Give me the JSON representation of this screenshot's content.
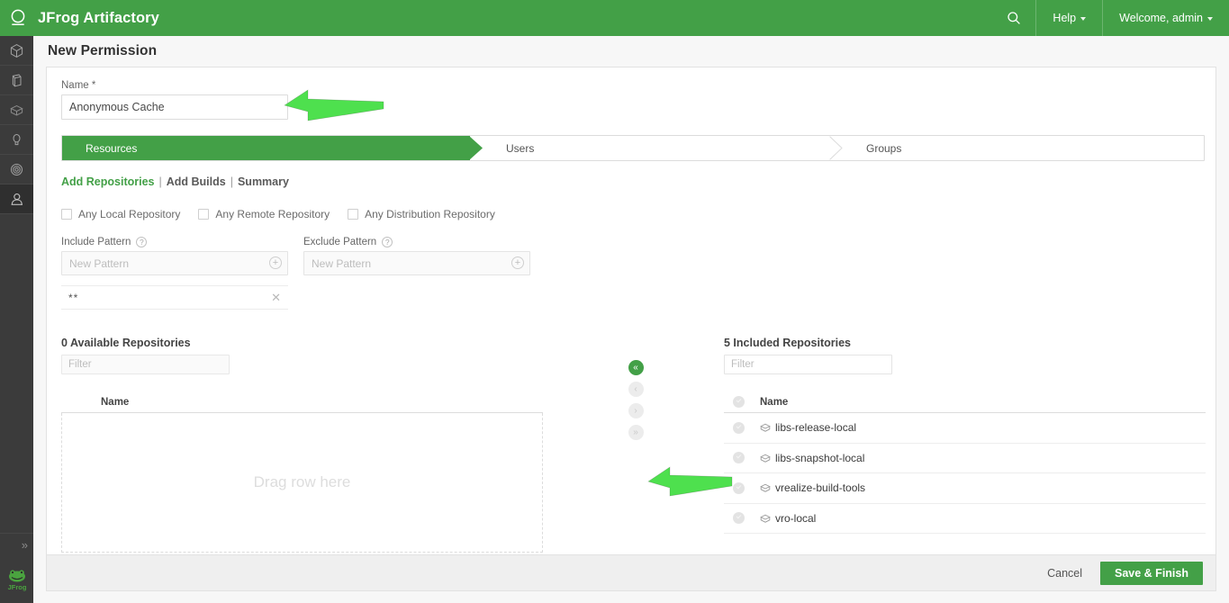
{
  "topbar": {
    "brand": "JFrog Artifactory",
    "logo_icon": "jfrog-circle-logo",
    "search_icon": "search-icon",
    "help_label": "Help",
    "user_label": "Welcome, admin",
    "accent_color": "#43a047"
  },
  "rail": {
    "items": [
      {
        "icon": "artifacts-cube-icon",
        "active": false
      },
      {
        "icon": "package-icon",
        "active": false
      },
      {
        "icon": "builds-box-icon",
        "active": false
      },
      {
        "icon": "search-magnifier-icon",
        "active": false
      },
      {
        "icon": "xray-target-icon",
        "active": false
      },
      {
        "icon": "admin-user-icon",
        "active": true
      }
    ],
    "expand_label": "»",
    "expand_icon": "chevron-double-right-icon",
    "footer_logo_icon": "jfrog-frog-logo"
  },
  "page": {
    "title": "New Permission"
  },
  "form": {
    "name_label": "Name *",
    "name_value": "Anonymous Cache",
    "name_placeholder": ""
  },
  "wizard": {
    "steps": [
      {
        "label": "Resources",
        "active": true
      },
      {
        "label": "Users",
        "active": false
      },
      {
        "label": "Groups",
        "active": false
      }
    ]
  },
  "sublinks": {
    "items": [
      {
        "label": "Add Repositories",
        "active": true
      },
      {
        "label": "Add Builds",
        "active": false
      },
      {
        "label": "Summary",
        "active": false
      }
    ],
    "separator": "|"
  },
  "checkboxes": [
    {
      "label": "Any Local Repository",
      "checked": false
    },
    {
      "label": "Any Remote Repository",
      "checked": false
    },
    {
      "label": "Any Distribution Repository",
      "checked": false
    }
  ],
  "patterns": {
    "include": {
      "label": "Include Pattern",
      "help_icon": "question-mark-icon",
      "placeholder": "New Pattern",
      "value": "",
      "add_icon": "plus-circle-icon"
    },
    "exclude": {
      "label": "Exclude Pattern",
      "help_icon": "question-mark-icon",
      "placeholder": "New Pattern",
      "value": "",
      "add_icon": "plus-circle-icon"
    },
    "chips": [
      {
        "text": "**",
        "remove_icon": "close-x-icon"
      }
    ]
  },
  "available_pane": {
    "title": "0 Available Repositories",
    "filter_placeholder": "Filter",
    "filter_value": "",
    "column_header": "Name",
    "empty_text": "Drag row here",
    "rows": []
  },
  "included_pane": {
    "title": "5 Included Repositories",
    "filter_placeholder": "Filter",
    "filter_value": "",
    "column_header": "Name",
    "rows": [
      {
        "name": "libs-release-local",
        "icon": "repository-cube-icon"
      },
      {
        "name": "libs-snapshot-local",
        "icon": "repository-cube-icon"
      },
      {
        "name": "vrealize-build-tools",
        "icon": "repository-cube-icon"
      },
      {
        "name": "vro-local",
        "icon": "repository-cube-icon"
      }
    ]
  },
  "transfer_buttons": [
    {
      "label": "«",
      "icon": "move-all-left-icon",
      "enabled": true
    },
    {
      "label": "‹",
      "icon": "move-left-icon",
      "enabled": false
    },
    {
      "label": "›",
      "icon": "move-right-icon",
      "enabled": false
    },
    {
      "label": "»",
      "icon": "move-all-right-icon",
      "enabled": false
    }
  ],
  "footer": {
    "cancel_label": "Cancel",
    "save_label": "Save & Finish"
  },
  "annotations": {
    "color": "#4ee04e",
    "arrows": [
      {
        "name": "arrow-pointing-to-name-field",
        "direction": "left"
      },
      {
        "name": "arrow-pointing-to-transfer-buttons",
        "direction": "left"
      }
    ]
  }
}
